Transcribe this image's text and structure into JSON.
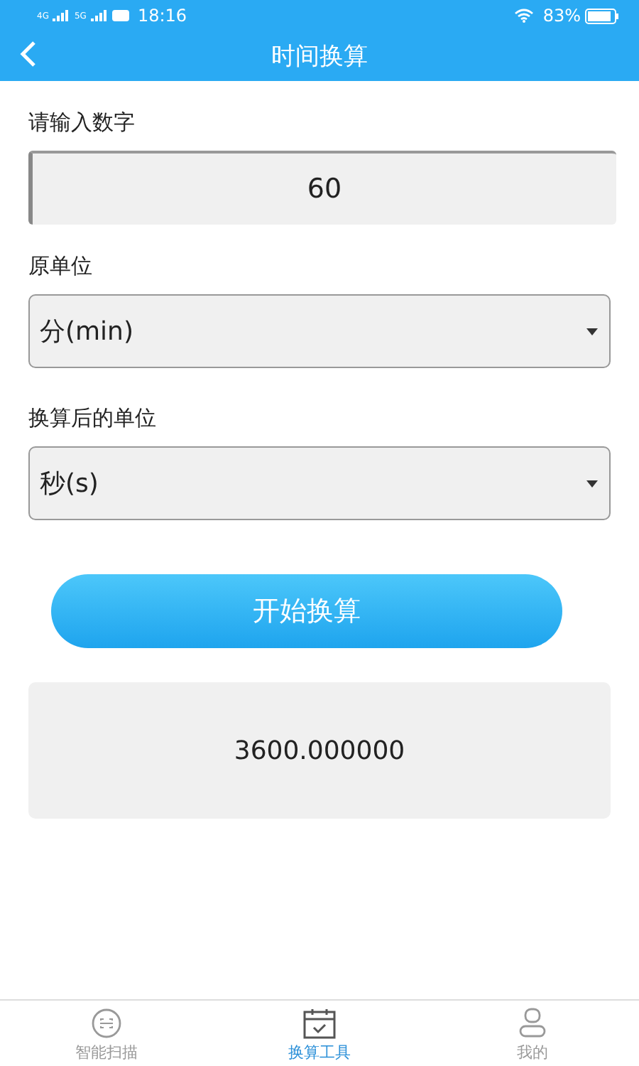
{
  "status_bar": {
    "network_1": "4G",
    "network_2": "5G",
    "time": "18:16",
    "battery": "83%"
  },
  "header": {
    "title": "时间换算"
  },
  "number_input": {
    "label": "请输入数字",
    "value": "60"
  },
  "from_unit": {
    "label": "原单位",
    "value": "分(min)"
  },
  "to_unit": {
    "label": "换算后的单位",
    "value": "秒(s)"
  },
  "convert_button": "开始换算",
  "result": "3600.000000",
  "tabs": [
    {
      "label": "智能扫描",
      "selected": false,
      "kind": "scan"
    },
    {
      "label": "换算工具",
      "selected": true,
      "kind": "calendar"
    },
    {
      "label": "我的",
      "selected": false,
      "kind": "person"
    }
  ]
}
